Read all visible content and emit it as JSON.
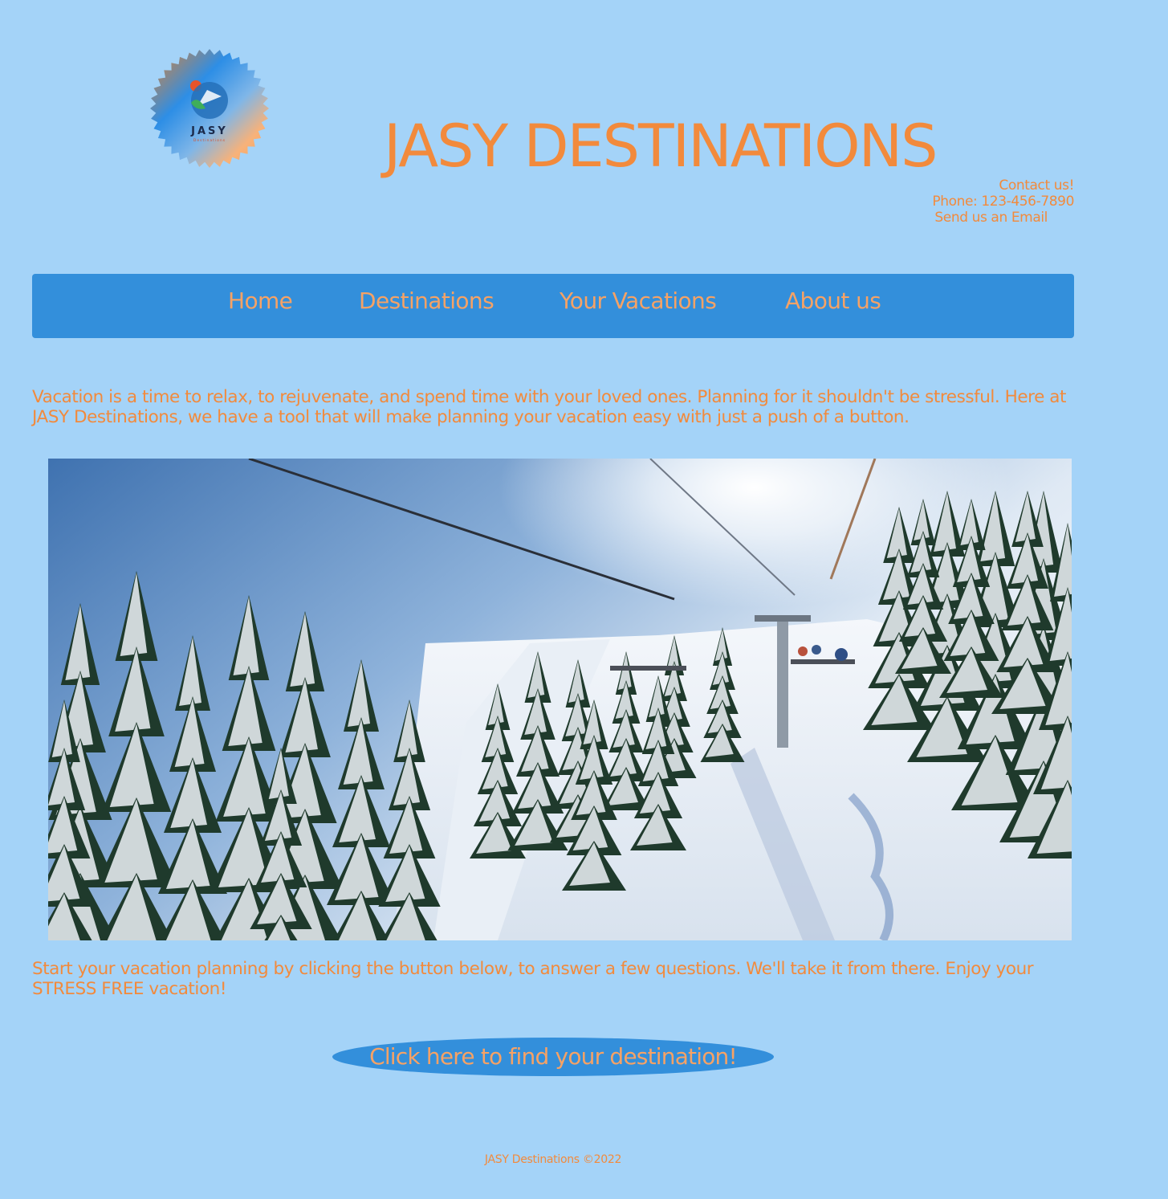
{
  "header": {
    "logo_text": "JASY",
    "logo_subtext": "Destinations",
    "site_title": "JASY DESTINATIONS"
  },
  "contact": {
    "heading": "Contact us!",
    "phone": "Phone: 123-456-7890",
    "email_link": "Send us an Email"
  },
  "nav": {
    "items": [
      {
        "label": "Home"
      },
      {
        "label": "Destinations"
      },
      {
        "label": "Your Vacations"
      },
      {
        "label": "About us"
      }
    ]
  },
  "main": {
    "intro": "Vacation is a time to relax, to rejuvenate, and spend time with your loved ones. Planning for it shouldn't be stressful. Here at JASY Destinations, we have a tool that will make planning your vacation easy with just a push of a button.",
    "outro": "Start your vacation planning by clicking the button below, to answer a few questions. We'll take it from there. Enjoy your STRESS FREE vacation!",
    "cta_label": "Click here to find your destination!"
  },
  "footer": {
    "text": "JASY Destinations ©2022"
  },
  "colors": {
    "page_background": "#a4d3f8",
    "nav_background": "#338fdb",
    "accent_orange": "#f28a3c",
    "nav_text": "#f6a265"
  }
}
